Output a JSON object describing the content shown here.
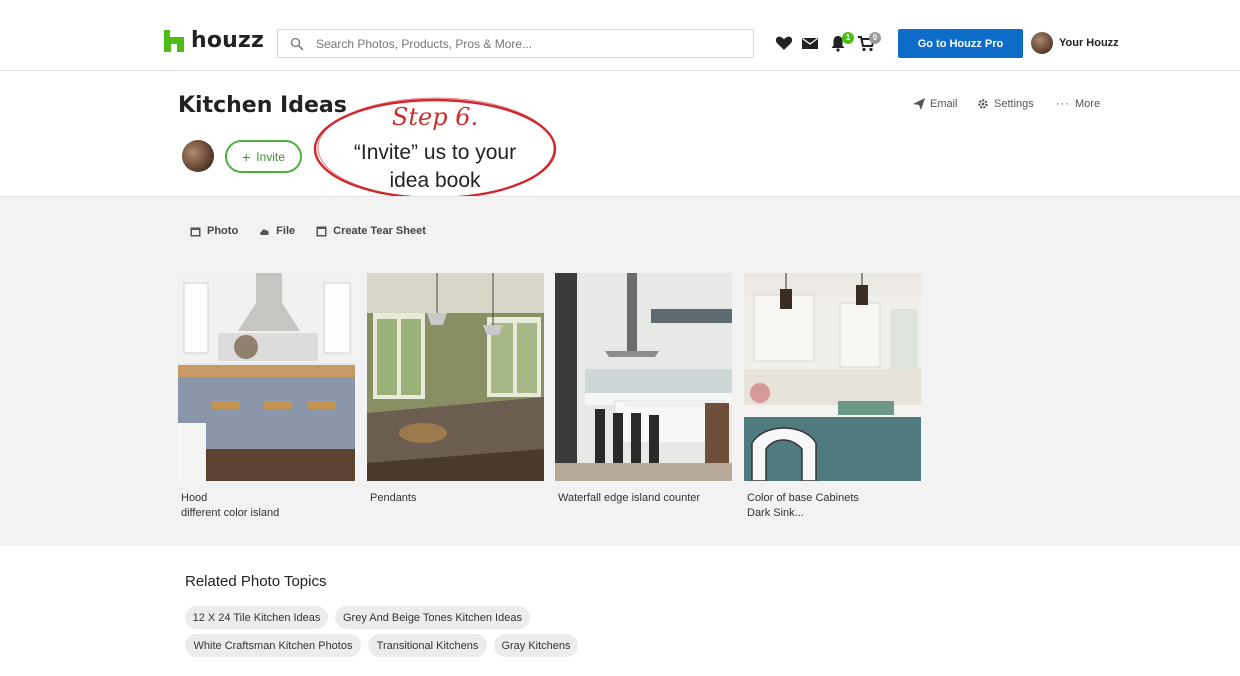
{
  "header": {
    "logo_text": "houzz",
    "search_placeholder": "Search Photos, Products, Pros & More...",
    "notification_count": "1",
    "cart_count": "0",
    "pro_button": "Go to Houzz Pro",
    "user_label": "Your Houzz",
    "brand_color": "#4dbc15",
    "pro_color": "#0d6cc8"
  },
  "ideabook": {
    "title": "Kitchen Ideas",
    "invite_label": "Invite",
    "actions": {
      "email": "Email",
      "settings": "Settings",
      "more": "More"
    }
  },
  "annotation": {
    "step": "Step 6.",
    "line1": "“Invite” us to your",
    "line2": "idea book",
    "ring_color": "#d0282c"
  },
  "tools": {
    "photo": "Photo",
    "file": "File",
    "tear_sheet": "Create Tear Sheet"
  },
  "cards": [
    {
      "line1": "Hood",
      "line2": "different color island"
    },
    {
      "line1": "Pendants",
      "line2": ""
    },
    {
      "line1": "Waterfall edge island counter",
      "line2": ""
    },
    {
      "line1": "Color of base Cabinets",
      "line2": "Dark Sink..."
    }
  ],
  "related": {
    "title": "Related Photo Topics",
    "chips": [
      "12 X 24 Tile Kitchen Ideas",
      "Grey And Beige Tones Kitchen Ideas",
      "White Craftsman Kitchen Photos",
      "Transitional Kitchens",
      "Gray Kitchens"
    ]
  }
}
